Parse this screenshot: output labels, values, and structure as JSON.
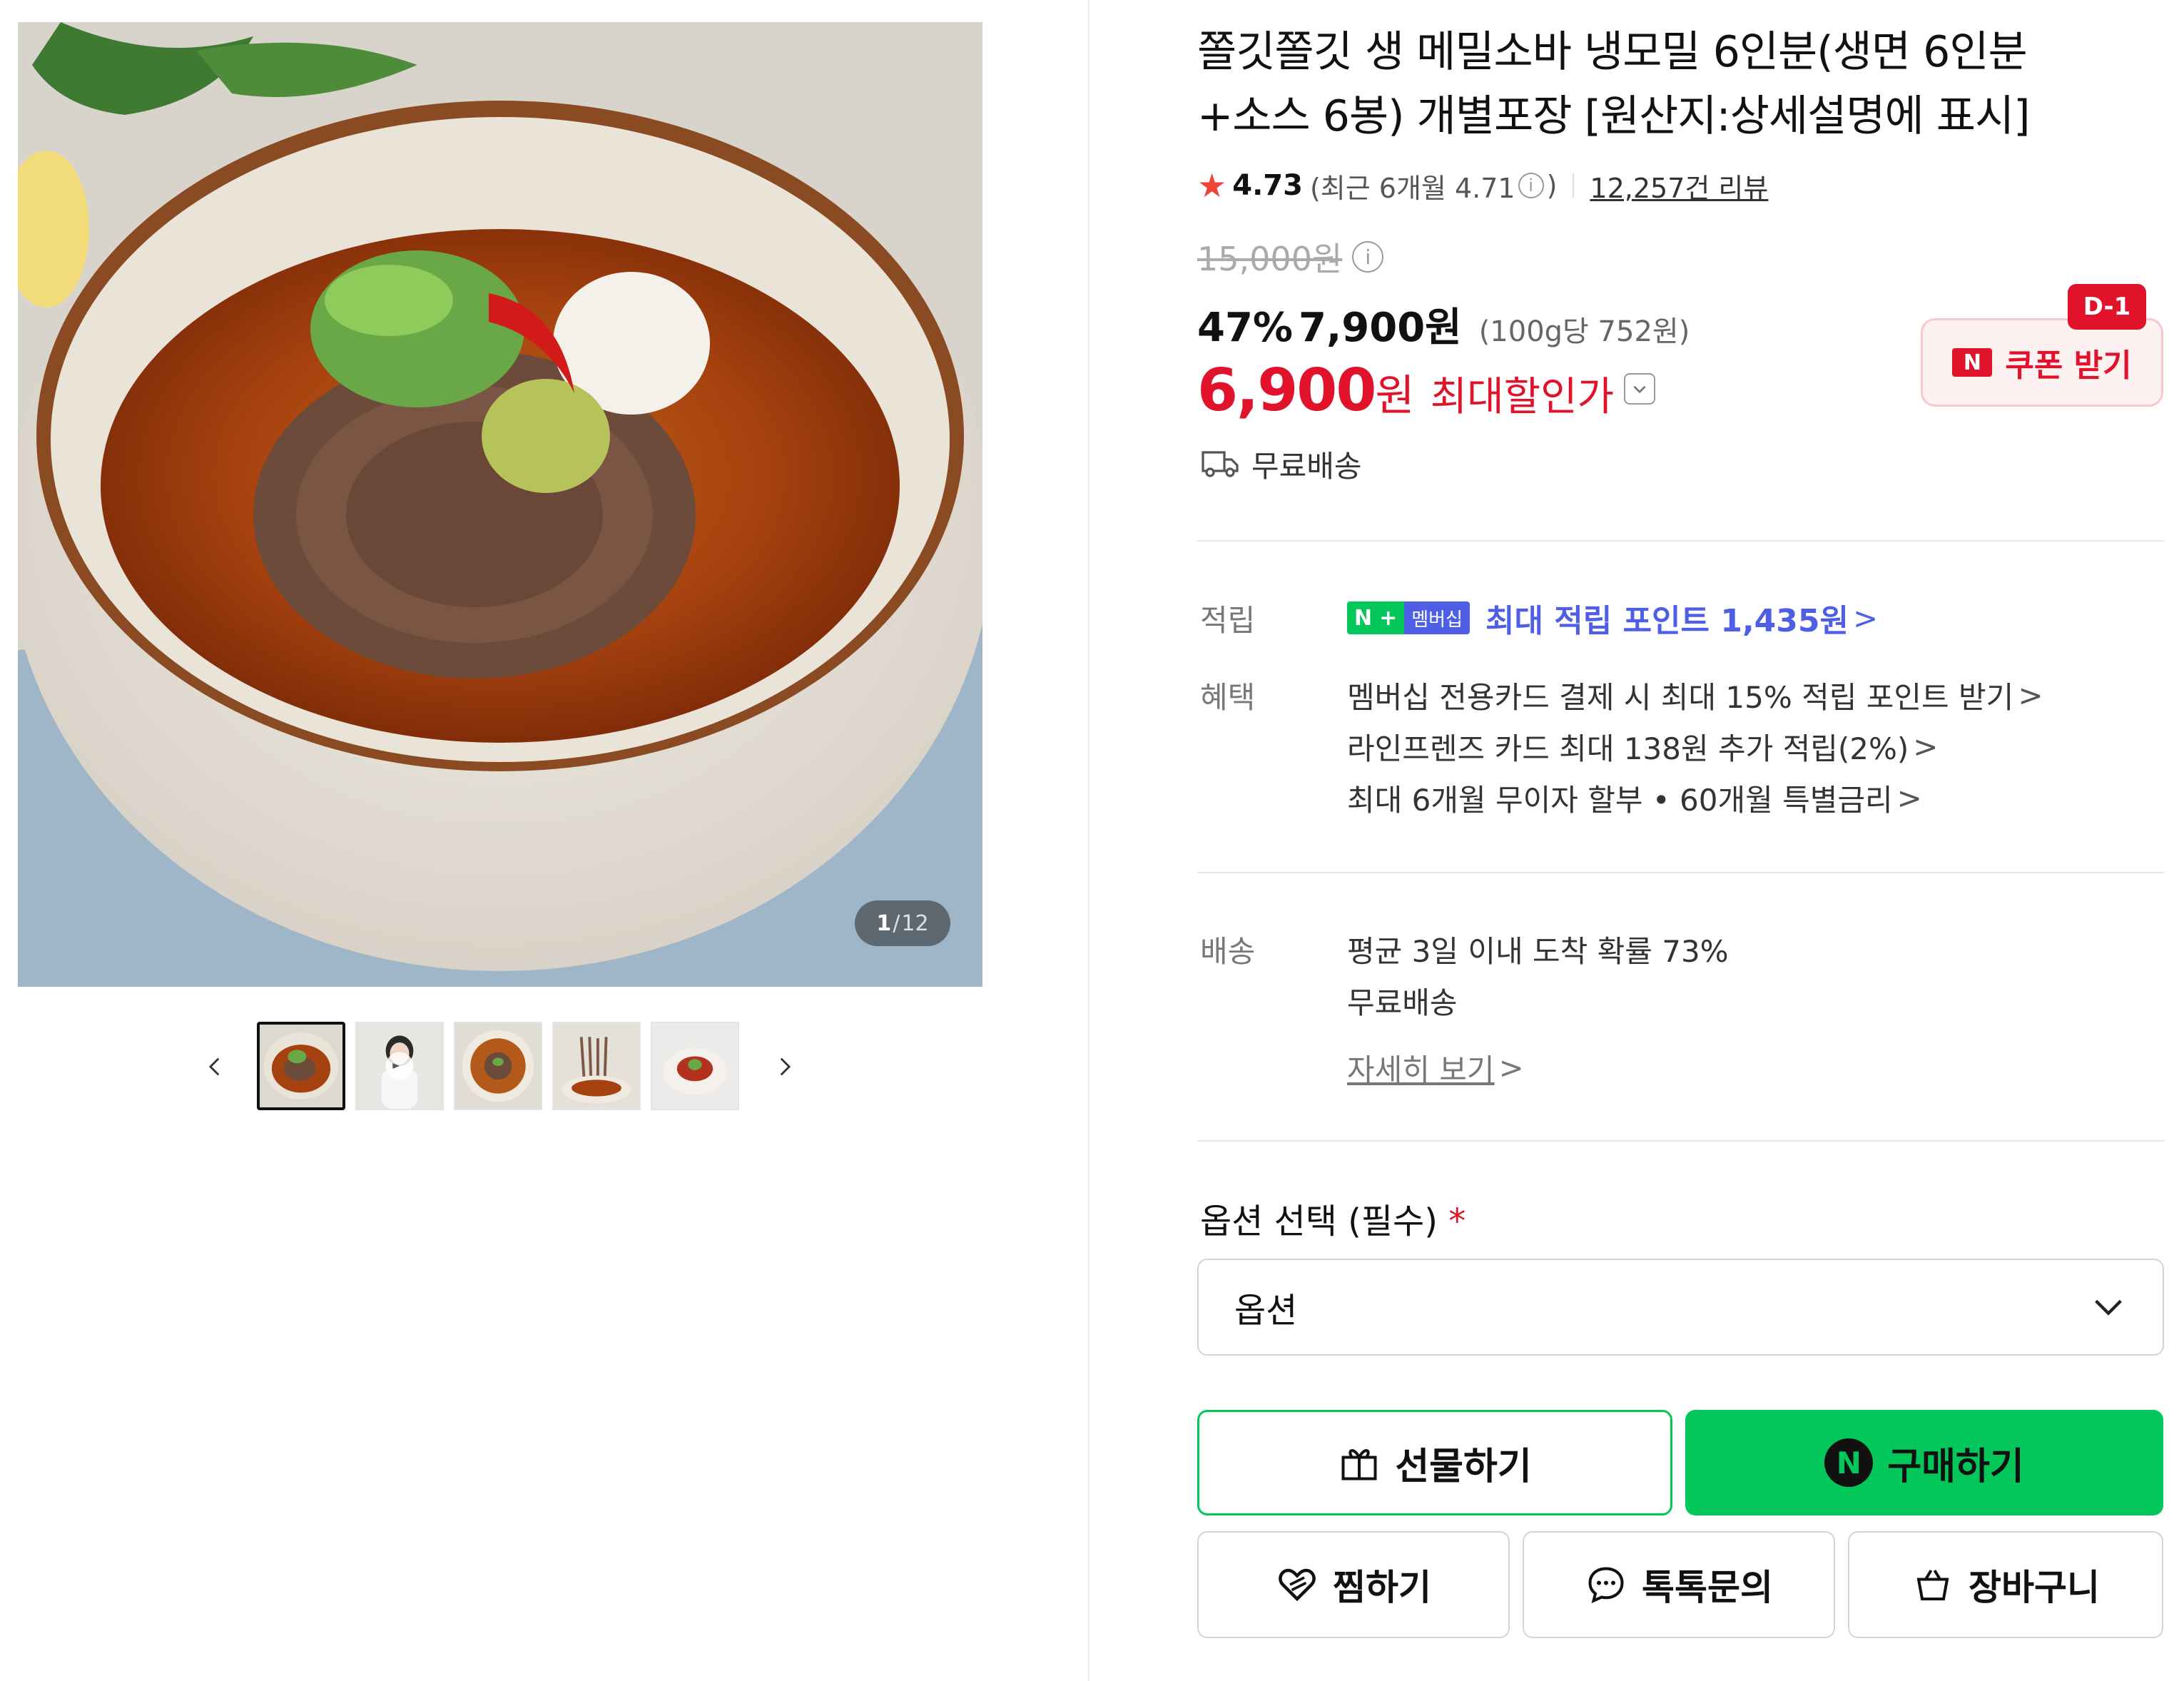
{
  "gallery": {
    "counter_current": "1",
    "counter_sep": "/",
    "counter_total": "12"
  },
  "product": {
    "title_line1": "쫄깃쫄깃 생 메밀소바 냉모밀 6인분(생면 6인분",
    "title_line2": "+소스 6봉) 개별포장 [원산지:상세설명에 표시]",
    "rating": "4.73",
    "recent_rating": "(최근 6개월 4.71",
    "recent_close": ")",
    "review_count": "12,257건 리뷰",
    "original_price": "15,000원",
    "discount_percent": "47%",
    "sale_price": "7,900원",
    "unit_price": "(100g당 752원)",
    "max_price": "6,900",
    "max_price_won": "원",
    "max_price_label": "최대할인가",
    "coupon_label": "쿠폰 받기",
    "coupon_logo": "N",
    "dday": "D-1",
    "shipping": "무료배송"
  },
  "benefits": {
    "points_label": "적립",
    "npay_n": "N",
    "npay_plus": "+",
    "npay_membership": "멤버십",
    "points_text": "최대 적립 포인트 1,435원",
    "benefit_label": "혜택",
    "benefit_items": [
      "멤버십 전용카드 결제 시 최대 15% 적립 포인트 받기",
      "라인프렌즈 카드 최대 138원 추가 적립(2%)",
      "최대 6개월 무이자 할부 • 60개월 특별금리"
    ],
    "arrow": ">"
  },
  "delivery": {
    "label": "배송",
    "line1": "평균 3일 이내 도착 확률 73%",
    "line2": "무료배송",
    "detail_link": "자세히 보기"
  },
  "options": {
    "title": "옵션 선택 (필수)",
    "required_mark": "*",
    "select_value": "옵션"
  },
  "actions": {
    "gift": "선물하기",
    "buy": "구매하기",
    "buy_logo": "N",
    "wish": "찜하기",
    "talk": "톡톡문의",
    "cart": "장바구니"
  },
  "colors": {
    "brand_green": "#03c75a",
    "sale_red": "#e0132b",
    "membership_blue": "#4e5fe5"
  }
}
